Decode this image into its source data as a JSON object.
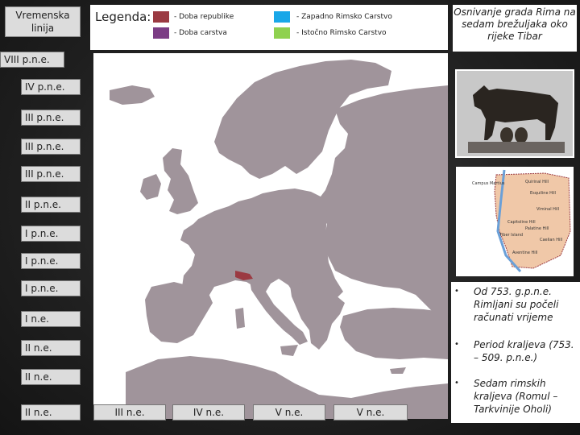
{
  "timeline_title": "Vremenska linija",
  "legend": {
    "title": "Legenda:",
    "items": [
      {
        "label": "- Doba republike",
        "color": "#9b3a42"
      },
      {
        "label": "- Zapadno  Rimsko  Carstvo",
        "color": "#19a7e8"
      },
      {
        "label": "- Doba carstva",
        "color": "#7c3d85"
      },
      {
        "label": "- Istočno  Rimsko  Carstvo",
        "color": "#8fd14f"
      }
    ]
  },
  "right_title": "Osnivanje grada Rima na sedam brežuljaka oko rijeke Tibar",
  "eras_left": [
    "VIII p.n.e.",
    "IV p.n.e.",
    "III p.n.e.",
    "III p.n.e.",
    "III p.n.e.",
    "II p.n.e.",
    "I p.n.e.",
    "I p.n.e.",
    "I p.n.e.",
    "I n.e.",
    "II n.e.",
    "II n.e.",
    "II n.e."
  ],
  "eras_bottom": [
    "III n.e.",
    "IV n.e.",
    "V n.e.",
    "V n.e."
  ],
  "bullets": [
    {
      "text": "Od 753. g.p.n.e. Rimljani su počeli računati vrijeme"
    },
    {
      "text": "Period kraljeva (753. – 509. p.n.e.)"
    },
    {
      "text": "Sedam rimskih kraljeva (Romul – Tarkvinije Oholi)"
    }
  ],
  "hills_map": {
    "labels": [
      "Esquiline Hill",
      "Quirinal Hill",
      "Viminal Hill",
      "Palatine Hill",
      "Capitoline Hill",
      "Aventine Hill",
      "Caelian Hill",
      "Tiber Island",
      "Campus Martius"
    ]
  },
  "colors": {
    "map_land": "#a0949b",
    "map_sea": "#ffffff",
    "rome_region": "#9b3a42",
    "hills_fill": "#f0c8a8"
  }
}
